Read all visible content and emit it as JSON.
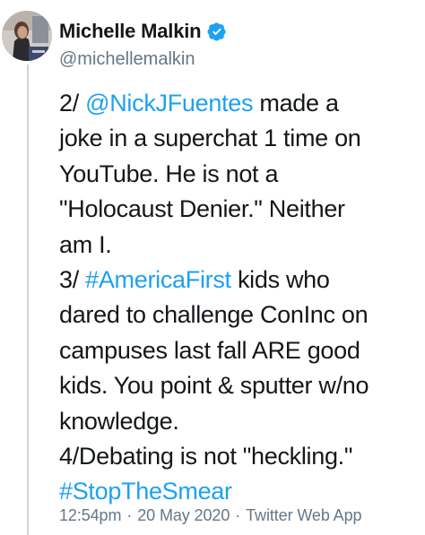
{
  "author": {
    "display_name": "Michelle Malkin",
    "handle": "@michellemalkin",
    "verified": true,
    "avatar_icon": "user-avatar-photo"
  },
  "tweet": {
    "lines": [
      [
        {
          "text": "2/ "
        },
        {
          "text": "@NickJFuentes",
          "link": true
        },
        {
          "text": " made a"
        }
      ],
      [
        {
          "text": "joke in a superchat 1 time on"
        }
      ],
      [
        {
          "text": "YouTube. He is not a"
        }
      ],
      [
        {
          "text": "\"Holocaust Denier.\" Neither"
        }
      ],
      [
        {
          "text": "am I."
        }
      ],
      [
        {
          "text": "3/ "
        },
        {
          "text": "#AmericaFirst",
          "link": true
        },
        {
          "text": " kids who"
        }
      ],
      [
        {
          "text": "dared to challenge ConInc on"
        }
      ],
      [
        {
          "text": "campuses last fall ARE good"
        }
      ],
      [
        {
          "text": "kids. You point & sputter w/no"
        }
      ],
      [
        {
          "text": "knowledge."
        }
      ],
      [
        {
          "text": "4/Debating is not \"heckling.\""
        }
      ],
      [
        {
          "text": "#StopTheSmear",
          "link": true
        }
      ]
    ]
  },
  "meta": {
    "time": "12:54pm",
    "date": "20 May 2020",
    "source": "Twitter Web App",
    "separator": "·"
  },
  "colors": {
    "text": "#14171a",
    "secondary": "#657786",
    "link": "#1da1f2",
    "verified_badge": "#1da1f2",
    "thread_line": "#ccd6dd"
  }
}
